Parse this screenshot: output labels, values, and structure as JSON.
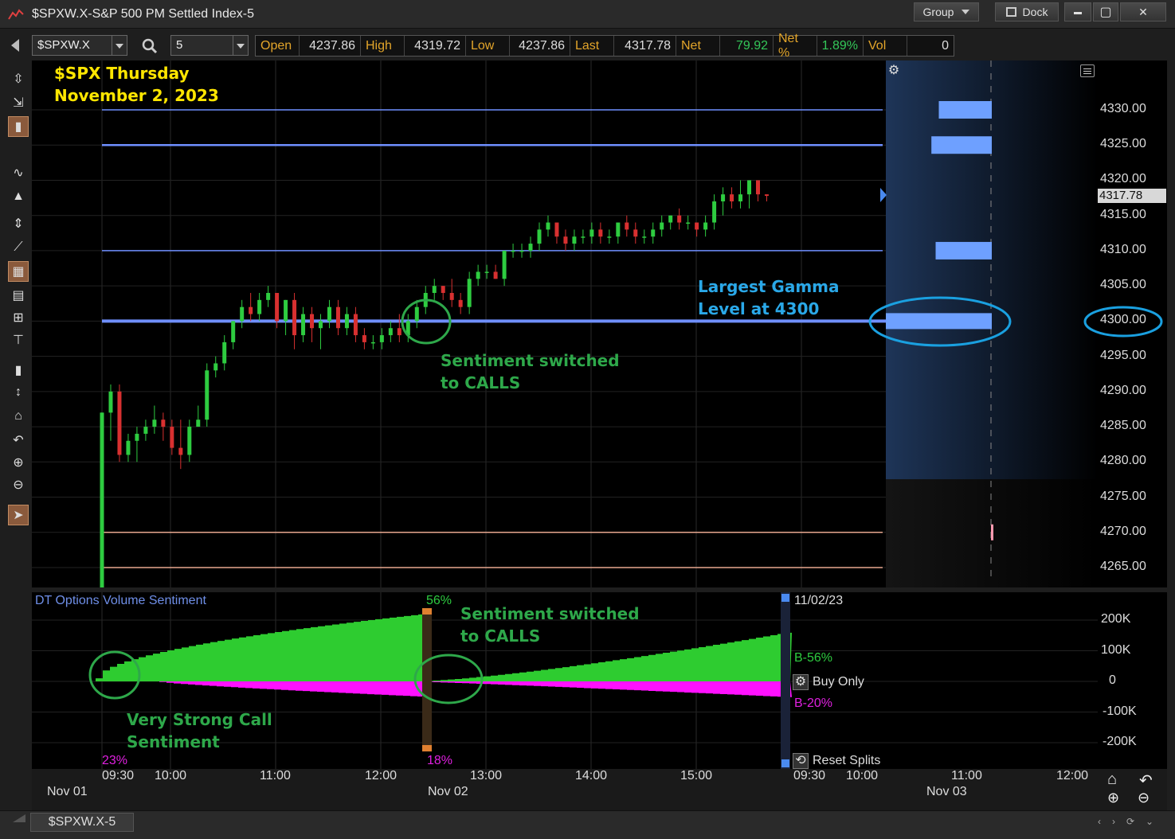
{
  "window": {
    "title": "$SPXW.X-S&P 500 PM Settled Index-5",
    "group_label": "Group",
    "dock_label": "Dock",
    "minimize_glyph": "▬",
    "maximize_glyph": "▢",
    "close_glyph": "✕"
  },
  "toolbar": {
    "symbol": "$SPXW.X",
    "interval": "5",
    "quote": {
      "open_label": "Open",
      "open": "4237.86",
      "high_label": "High",
      "high": "4319.72",
      "low_label": "Low",
      "low": "4237.86",
      "last_label": "Last",
      "last": "4317.78",
      "net_label": "Net",
      "net": "79.92",
      "netpct_label": "Net %",
      "netpct": "1.89%",
      "vol_label": "Vol",
      "vol": "0"
    }
  },
  "left_tools": [
    "cursor-crosshair-icon",
    "move-icon",
    "candle-style-icon",
    "line-style-icon",
    "mountain-style-icon",
    "scale-icon",
    "trendline-icon",
    "grid-icon",
    "table-icon",
    "table-small-icon",
    "fib-icon",
    "pin-icon",
    "split-icon",
    "home-icon",
    "undo-icon",
    "zoom-in-icon",
    "zoom-out-icon",
    "pointer-icon"
  ],
  "annotations": {
    "title_line1": "$SPX Thursday",
    "title_line2": "November 2, 2023",
    "gamma_line1": "Largest Gamma",
    "gamma_line2": "Level at 4300",
    "sentiment_main_1": "Sentiment switched",
    "sentiment_main_2": "to CALLS",
    "sentiment_vol_1": "Sentiment switched",
    "sentiment_vol_2": "to CALLS",
    "strong_1": "Very Strong Call",
    "strong_2": "Sentiment"
  },
  "price_axis": {
    "labels": [
      "4330.00",
      "4325.00",
      "4320.00",
      "4315.00",
      "4310.00",
      "4305.00",
      "4300.00",
      "4295.00",
      "4290.00",
      "4285.00",
      "4280.00",
      "4275.00",
      "4270.00",
      "4265.00"
    ],
    "last_tag": "4317.78"
  },
  "volume_panel": {
    "title": "DT Options Volume Sentiment",
    "date_label": "11/02/23",
    "top_pct": "56%",
    "bottom_pct_left": "23%",
    "bottom_pct_mid": "18%",
    "buy_label": "B-56%",
    "sell_label": "B-20%",
    "buy_only_label": "Buy Only",
    "reset_label": "Reset Splits",
    "axis_labels": [
      "200K",
      "100K",
      "0",
      "-100K",
      "-200K"
    ]
  },
  "time_axis": {
    "times": [
      "09:30",
      "10:00",
      "11:00",
      "12:00",
      "13:00",
      "14:00",
      "15:00",
      "09:30",
      "10:00",
      "11:00",
      "12:00"
    ],
    "dates": [
      "Nov 01",
      "Nov 02",
      "Nov 03"
    ]
  },
  "tab": {
    "label": "$SPXW.X-5"
  },
  "chart_data": {
    "type": "candlestick",
    "title": "$SPX Thursday November 2, 2023",
    "ylim": [
      4262.5,
      4333.5
    ],
    "yticks": [
      4265,
      4270,
      4275,
      4280,
      4285,
      4290,
      4295,
      4300,
      4305,
      4310,
      4315,
      4320,
      4325,
      4330
    ],
    "horizontal_levels": [
      4330,
      4325,
      4310,
      4300,
      4270,
      4265
    ],
    "gamma_levels": [
      {
        "price": 4330,
        "size": 0.5
      },
      {
        "price": 4325,
        "size": 0.57
      },
      {
        "price": 4310,
        "size": 0.53
      },
      {
        "price": 4300,
        "size": 1.0
      }
    ],
    "candles": [
      [
        4262,
        4287,
        4262,
        4287
      ],
      [
        4287,
        4291,
        4283,
        4290
      ],
      [
        4290,
        4291,
        4280,
        4281
      ],
      [
        4281,
        4284,
        4280,
        4283
      ],
      [
        4283,
        4285,
        4280,
        4284
      ],
      [
        4284,
        4286,
        4283,
        4285
      ],
      [
        4285,
        4288,
        4284,
        4286
      ],
      [
        4286,
        4287,
        4283,
        4285
      ],
      [
        4285,
        4286,
        4281,
        4282
      ],
      [
        4282,
        4286,
        4279,
        4281
      ],
      [
        4281,
        4286,
        4280,
        4285
      ],
      [
        4285,
        4288,
        4285,
        4286
      ],
      [
        4286,
        4294,
        4285,
        4293
      ],
      [
        4293,
        4295,
        4292,
        4294
      ],
      [
        4294,
        4298,
        4293,
        4297
      ],
      [
        4297,
        4300,
        4296,
        4300
      ],
      [
        4300,
        4303,
        4299,
        4302
      ],
      [
        4302,
        4304,
        4300,
        4301
      ],
      [
        4301,
        4304,
        4300,
        4303
      ],
      [
        4303,
        4305,
        4302,
        4304
      ],
      [
        4304,
        4304,
        4299,
        4300
      ],
      [
        4300,
        4303,
        4298,
        4303
      ],
      [
        4303,
        4304,
        4296,
        4298
      ],
      [
        4298,
        4302,
        4297,
        4301
      ],
      [
        4301,
        4302,
        4297,
        4299
      ],
      [
        4299,
        4301,
        4296,
        4300
      ],
      [
        4300,
        4303,
        4299,
        4302
      ],
      [
        4302,
        4303,
        4298,
        4299
      ],
      [
        4299,
        4302,
        4298,
        4301
      ],
      [
        4301,
        4302,
        4297,
        4298
      ],
      [
        4298,
        4299,
        4296,
        4297
      ],
      [
        4297,
        4298,
        4296,
        4297
      ],
      [
        4297,
        4299,
        4296,
        4298
      ],
      [
        4298,
        4300,
        4297,
        4299
      ],
      [
        4299,
        4301,
        4297,
        4298
      ],
      [
        4298,
        4301,
        4297,
        4300
      ],
      [
        4300,
        4303,
        4299,
        4302
      ],
      [
        4302,
        4305,
        4301,
        4304
      ],
      [
        4304,
        4306,
        4303,
        4305
      ],
      [
        4305,
        4305,
        4303,
        4304
      ],
      [
        4304,
        4306,
        4302,
        4303
      ],
      [
        4303,
        4304,
        4301,
        4302
      ],
      [
        4302,
        4307,
        4301,
        4306
      ],
      [
        4306,
        4308,
        4305,
        4307
      ],
      [
        4307,
        4308,
        4306,
        4307
      ],
      [
        4307,
        4308,
        4306,
        4306
      ],
      [
        4306,
        4310,
        4305,
        4310
      ],
      [
        4310,
        4311,
        4309,
        4310
      ],
      [
        4310,
        4311,
        4309,
        4310
      ],
      [
        4310,
        4312,
        4309,
        4311
      ],
      [
        4311,
        4314,
        4310,
        4313
      ],
      [
        4313,
        4315,
        4312,
        4314
      ],
      [
        4314,
        4314,
        4311,
        4312
      ],
      [
        4312,
        4313,
        4310,
        4311
      ],
      [
        4311,
        4313,
        4310,
        4312
      ],
      [
        4312,
        4313,
        4311,
        4312
      ],
      [
        4312,
        4314,
        4311,
        4313
      ],
      [
        4313,
        4314,
        4311,
        4312
      ],
      [
        4312,
        4313,
        4311,
        4312
      ],
      [
        4312,
        4314,
        4311,
        4314
      ],
      [
        4314,
        4315,
        4312,
        4313
      ],
      [
        4313,
        4314,
        4311,
        4312
      ],
      [
        4312,
        4313,
        4311,
        4312
      ],
      [
        4312,
        4314,
        4311,
        4313
      ],
      [
        4313,
        4315,
        4312,
        4314
      ],
      [
        4314,
        4315,
        4313,
        4315
      ],
      [
        4315,
        4316,
        4313,
        4314
      ],
      [
        4314,
        4315,
        4313,
        4314
      ],
      [
        4314,
        4314,
        4312,
        4313
      ],
      [
        4313,
        4315,
        4312,
        4314
      ],
      [
        4314,
        4318,
        4313,
        4317
      ],
      [
        4317,
        4319,
        4315,
        4318
      ],
      [
        4318,
        4319,
        4316,
        4317
      ],
      [
        4317,
        4320,
        4316,
        4318
      ],
      [
        4318,
        4320,
        4316,
        4320
      ],
      [
        4320,
        4320,
        4317,
        4318
      ],
      [
        4318,
        4318,
        4317,
        4317.78
      ]
    ],
    "volume_sentiment": {
      "ylim": [
        -250000,
        250000
      ],
      "yticks": [
        200000,
        100000,
        0,
        -100000,
        -200000
      ],
      "buy_series": "cumulative call volume (green)",
      "sell_series": "cumulative put volume (magenta)"
    }
  }
}
